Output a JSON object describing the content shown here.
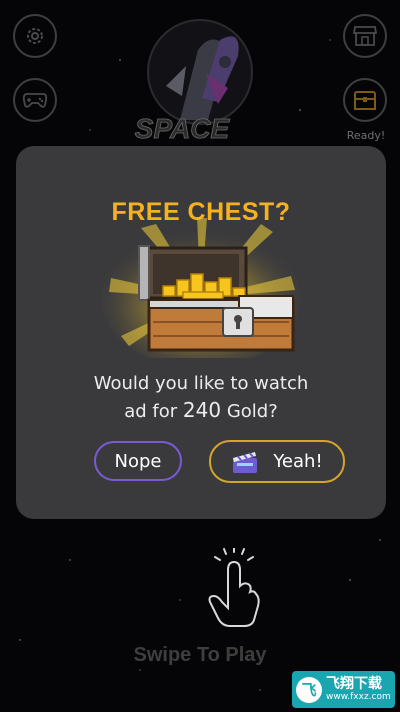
{
  "hud": {
    "ready_label": "Ready!",
    "icons": [
      "gear-icon",
      "gamepad-icon",
      "shop-icon",
      "chest-icon"
    ]
  },
  "logo": {
    "text_line1": "SPACE"
  },
  "dialog": {
    "title": "FREE CHEST?",
    "message_prefix": "Would you like to watch",
    "message_mid": "ad for",
    "amount": "240",
    "message_suffix": "Gold?",
    "nope_label": "Nope",
    "yeah_label": "Yeah!",
    "colors": {
      "title": "#f5b21e",
      "nope_border": "#7a5bd6",
      "yeah_border": "#d5a52a"
    }
  },
  "footer": {
    "swipe_label": "Swipe To Play"
  },
  "watermark": {
    "title": "飞翔下载",
    "url": "www.fxxz.com"
  }
}
